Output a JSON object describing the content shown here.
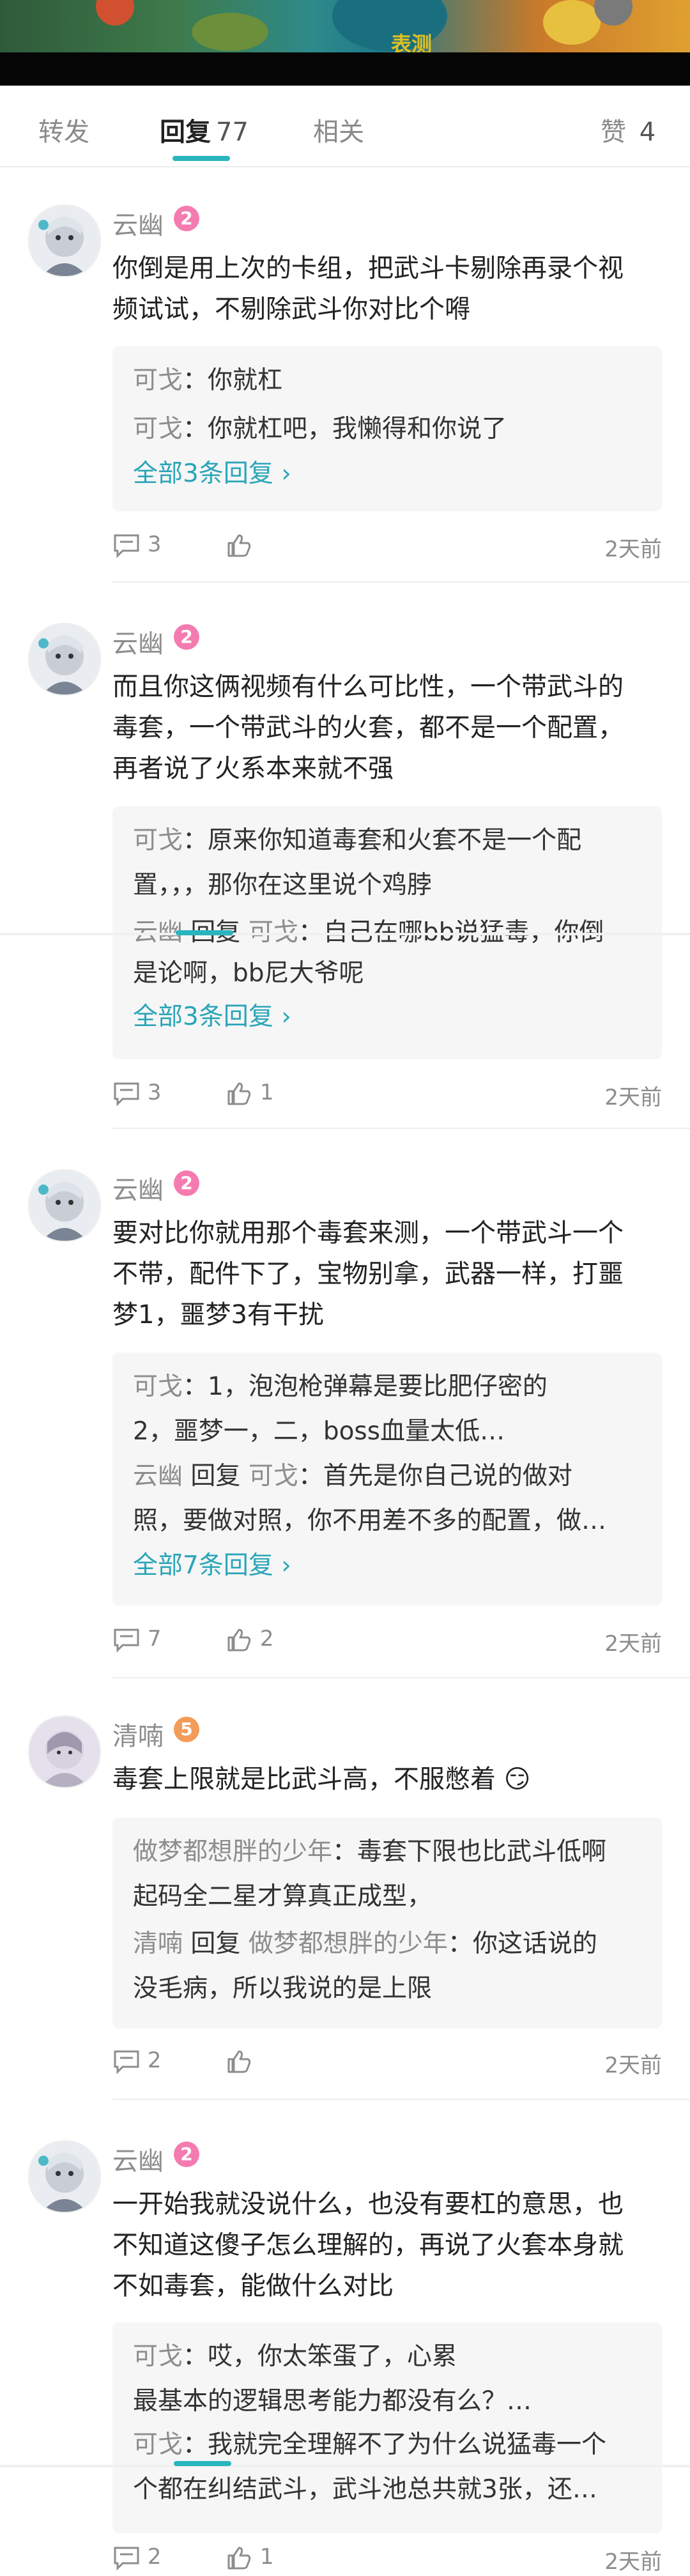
{
  "banner": {
    "title_fragment": "表测"
  },
  "tabs": [
    {
      "label": "转发",
      "count": ""
    },
    {
      "label": "回复",
      "count": "77"
    },
    {
      "label": "相关",
      "count": ""
    },
    {
      "label": "赞",
      "count": "4"
    }
  ],
  "comments": [
    {
      "user": "云幽",
      "badge": "2",
      "badge_color": "#f47bb0",
      "text_lines": [
        "你倒是用上次的卡组，把武斗卡剔除再录个视",
        "频试试，不剔除武斗你对比个嘚"
      ],
      "replies": [
        {
          "from": "可戈",
          "reply_word": "",
          "to": "",
          "text": "：你就杠"
        },
        {
          "from": "可戈",
          "reply_word": "",
          "to": "",
          "text": "：你就杠吧，我懒得和你说了"
        }
      ],
      "more": "全部3条回复 ›",
      "comment_count": "3",
      "like_count": "",
      "time": "2天前"
    },
    {
      "user": "云幽",
      "badge": "2",
      "badge_color": "#f47bb0",
      "text_lines": [
        "而且你这俩视频有什么可比性，一个带武斗的",
        "毒套，一个带武斗的火套，都不是一个配置，",
        "再者说了火系本来就不强"
      ],
      "replies": [
        {
          "from": "可戈",
          "reply_word": "",
          "to": "",
          "text": "：原来你知道毒套和火套不是一个配"
        },
        {
          "from": "",
          "reply_word": "",
          "to": "",
          "text": "置，，，那你在这里说个鸡脖"
        },
        {
          "from": "云幽",
          "reply_word": "回复",
          "to": "可戈",
          "text": "：自己在哪bb说猛毒，你倒"
        },
        {
          "from": "",
          "reply_word": "",
          "to": "",
          "text": "是论啊，bb尼大爷呢"
        }
      ],
      "more": "全部3条回复 ›",
      "comment_count": "3",
      "like_count": "1",
      "time": "2天前"
    },
    {
      "user": "云幽",
      "badge": "2",
      "badge_color": "#f47bb0",
      "text_lines": [
        "要对比你就用那个毒套来测，一个带武斗一个",
        "不带，配件下了，宝物别拿，武器一样，打噩",
        "梦1，噩梦3有干扰"
      ],
      "replies": [
        {
          "from": "可戈",
          "reply_word": "",
          "to": "",
          "text": "：1，泡泡枪弹幕是要比肥仔密的"
        },
        {
          "from": "",
          "reply_word": "",
          "to": "",
          "text": "2，噩梦一，二，boss血量太低…"
        },
        {
          "from": "云幽",
          "reply_word": "回复",
          "to": "可戈",
          "text": "：首先是你自己说的做对"
        },
        {
          "from": "",
          "reply_word": "",
          "to": "",
          "text": "照，要做对照，你不用差不多的配置，做…"
        }
      ],
      "more": "全部7条回复 ›",
      "comment_count": "7",
      "like_count": "2",
      "time": "2天前"
    },
    {
      "user": "清喃",
      "badge": "5",
      "badge_color": "#f39c5a",
      "text_lines": [
        "毒套上限就是比武斗高，不服憋着 😏"
      ],
      "replies": [
        {
          "from": "做梦都想胖的少年",
          "reply_word": "",
          "to": "",
          "text": "：毒套下限也比武斗低啊"
        },
        {
          "from": "",
          "reply_word": "",
          "to": "",
          "text": "起码全二星才算真正成型，"
        },
        {
          "from": "清喃",
          "reply_word": "回复",
          "to": "做梦都想胖的少年",
          "text": "：你这话说的"
        },
        {
          "from": "",
          "reply_word": "",
          "to": "",
          "text": "没毛病，所以我说的是上限"
        }
      ],
      "more": "",
      "comment_count": "2",
      "like_count": "",
      "time": "2天前"
    },
    {
      "user": "云幽",
      "badge": "2",
      "badge_color": "#f47bb0",
      "text_lines": [
        "一开始我就没说什么，也没有要杠的意思，也",
        "不知道这傻子怎么理解的，再说了火套本身就",
        "不如毒套，能做什么对比"
      ],
      "replies": [
        {
          "from": "可戈",
          "reply_word": "",
          "to": "",
          "text": "：哎，你太笨蛋了，心累"
        },
        {
          "from": "",
          "reply_word": "",
          "to": "",
          "text": "最基本的逻辑思考能力都没有么？…"
        },
        {
          "from": "可戈",
          "reply_word": "",
          "to": "",
          "text": "：我就完全理解不了为什么说猛毒一个"
        },
        {
          "from": "",
          "reply_word": "",
          "to": "",
          "text": "个都在纠结武斗，武斗池总共就3张，还…"
        }
      ],
      "more": "",
      "comment_count": "2",
      "like_count": "1",
      "time": "2天前"
    }
  ]
}
